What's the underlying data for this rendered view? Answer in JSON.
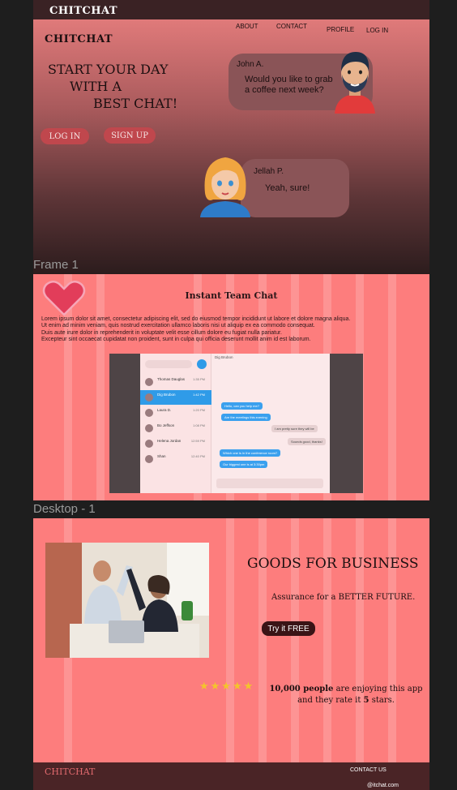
{
  "frame1": {
    "top_logo": "CHITCHAT",
    "logo": "CHITCHAT",
    "nav": [
      "ABOUT",
      "CONTACT",
      "PROFILE",
      "LOG IN"
    ],
    "hero": [
      "START YOUR DAY",
      "WITH A",
      "BEST CHAT!"
    ],
    "login_button": "LOG IN",
    "signup_button": "SIGN UP",
    "chat": [
      {
        "name": "John A.",
        "message": "Would you like to grab a coffee next week?"
      },
      {
        "name": "Jellah P.",
        "message": "Yeah, sure!"
      }
    ]
  },
  "labels": {
    "frame1": "Frame 1",
    "desktop1": "Desktop - 1"
  },
  "desktop1": {
    "title": "Instant Team Chat",
    "paragraph": [
      "Lorem ipsum dolor sit amet, consectetur adipiscing elit, sed do eiusmod tempor incididunt ut labore et dolore magna aliqua.",
      "Ut enim ad minim veniam, quis nostrud exercitation ullamco laboris nisi ut aliquip ex ea commodo consequat.",
      "Duis aute irure dolor in reprehenderit in voluptate velit esse cillum dolore eu fugiat nulla pariatur.",
      "Excepteur sint occaecat cupidatat non proident, sunt in culpa qui officia deserunt mollit anim id est laborum."
    ],
    "app_header": "Dig Brubon",
    "contacts": [
      {
        "name": "Thomas Dauglas",
        "time": "1:35 PM"
      },
      {
        "name": "Dig Brubon",
        "time": "1:42 PM"
      },
      {
        "name": "Laura D.",
        "time": "1:20 PM"
      },
      {
        "name": "Bo Jeffson",
        "time": "1:08 PM"
      },
      {
        "name": "Helena Jordan",
        "time": "12:59 PM"
      },
      {
        "name": "Shan",
        "time": "12:40 PM"
      }
    ],
    "messages": [
      {
        "dir": "in",
        "text": "Hello, can you help me?"
      },
      {
        "dir": "in",
        "text": "Are the meetings this evening"
      },
      {
        "dir": "out",
        "text": "I am pretty sure they will be"
      },
      {
        "dir": "out",
        "text": "Sounds good, thanks!"
      },
      {
        "dir": "in",
        "text": "Which one is in the conference room?"
      },
      {
        "dir": "in",
        "text": "Our biggest one is at 3:30pm"
      }
    ]
  },
  "frame3": {
    "headline": "GOODS FOR BUSINESS",
    "tagline": "Assurance for a BETTER FUTURE.",
    "cta": "Try it FREE",
    "stars": "★★★★★",
    "rating": {
      "count": "10,000 people",
      "mid": " are enjoying this app and they rate it ",
      "num": "5",
      "end": " stars."
    },
    "footer_logo": "CHITCHAT",
    "footer_contact": "CONTACT US",
    "footer_email": "@itchat.com",
    "colors": {
      "pink": "#fd7d7d",
      "dark": "#4a2426",
      "star": "#f3c42b"
    }
  }
}
